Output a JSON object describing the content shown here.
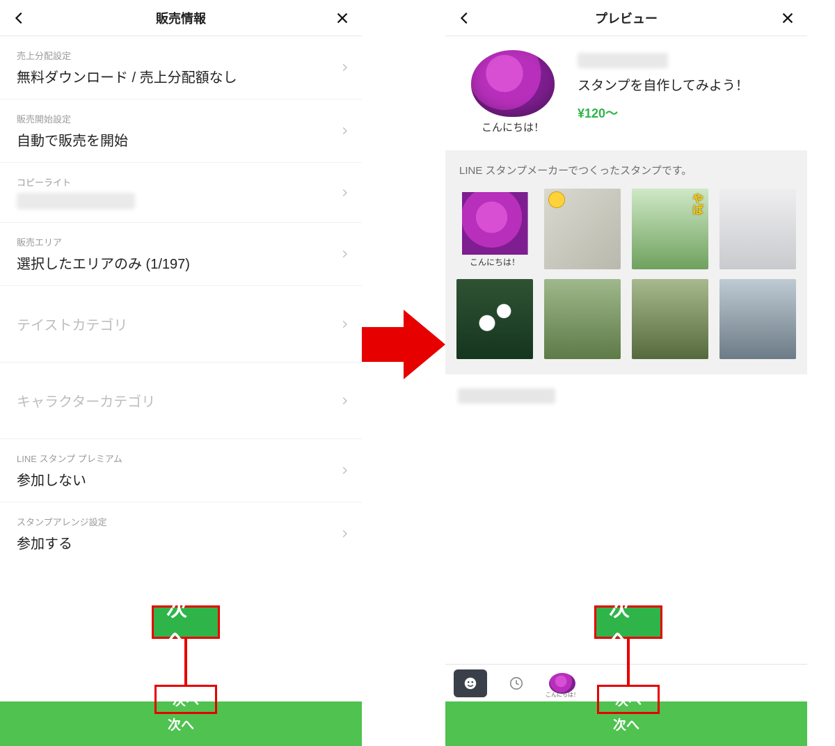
{
  "left": {
    "header_title": "販売情報",
    "rows": [
      {
        "label": "売上分配設定",
        "value": "無料ダウンロード / 売上分配額なし",
        "disabled": false
      },
      {
        "label": "販売開始設定",
        "value": "自動で販売を開始",
        "disabled": false
      },
      {
        "label": "コピーライト",
        "value": "",
        "disabled": false,
        "blurred": true
      },
      {
        "label": "販売エリア",
        "value": "選択したエリアのみ (1/197)",
        "disabled": false
      },
      {
        "label": "",
        "value": "テイストカテゴリ",
        "disabled": true,
        "single": true
      },
      {
        "label": "",
        "value": "キャラクターカテゴリ",
        "disabled": true,
        "single": true
      },
      {
        "label": "LINE スタンプ プレミアム",
        "value": "参加しない",
        "disabled": false
      },
      {
        "label": "スタンプアレンジ設定",
        "value": "参加する",
        "disabled": false
      }
    ],
    "next_big": "次へ",
    "next_bar": "次へ"
  },
  "right": {
    "header_title": "プレビュー",
    "hero_caption": "こんにちは！",
    "pack_title": "スタンプを自作してみよう！",
    "pack_price": "¥120～",
    "grid_note": "LINE スタンプメーカーでつくったスタンプです。",
    "tile1_caption": "こんにちは！",
    "tab_mini_caption": "こんにちは！",
    "next_big": "次へ",
    "next_bar": "次へ"
  }
}
